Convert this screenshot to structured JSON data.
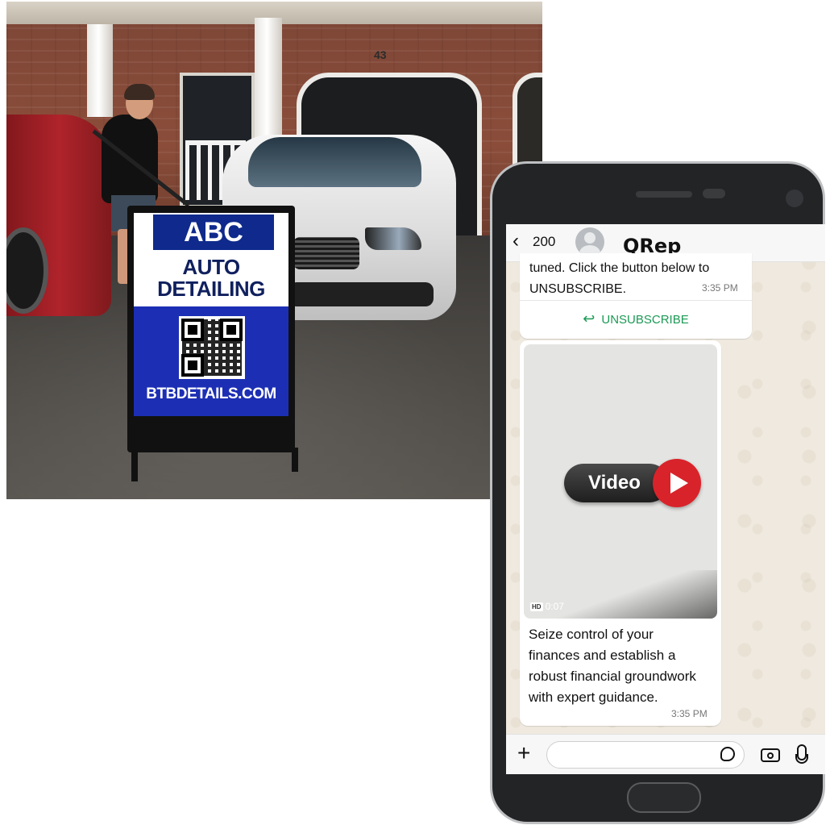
{
  "sign": {
    "badge": "ABC",
    "line1": "AUTO",
    "line2": "DETAILING",
    "url": "BTBDETAILS.COM"
  },
  "house": {
    "number": "43"
  },
  "chat": {
    "back_count": "200",
    "contact_name": "QRep",
    "message1": {
      "text_line1": "tuned. Click the button below to",
      "text_line2": "UNSUBSCRIBE.",
      "time": "3:35 PM",
      "button_label": "UNSUBSCRIBE"
    },
    "message2": {
      "video_label": "Video",
      "hd_badge": "HD",
      "duration": "0:07",
      "caption_line1": "Seize control of your",
      "caption_line2": "finances and establish a",
      "caption_line3": "robust financial groundwork",
      "caption_line4": "with expert guidance.",
      "time": "3:35 PM"
    },
    "input": {
      "placeholder": ""
    }
  },
  "icons": {
    "back": "chevron-left-icon",
    "reply": "reply-icon",
    "play": "play-icon",
    "plus": "plus-icon",
    "sticker": "sticker-icon",
    "camera": "camera-icon",
    "mic": "microphone-icon"
  },
  "colors": {
    "sign_blue": "#1c2fb4",
    "badge_navy": "#0f2a8c",
    "unsubscribe_green": "#1b9a55",
    "play_red": "#d9232a",
    "chat_bg": "#efe9df"
  }
}
